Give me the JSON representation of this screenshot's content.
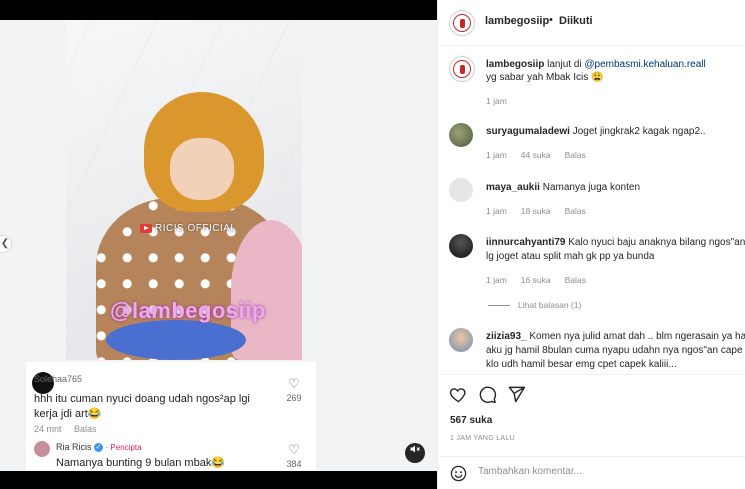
{
  "video": {
    "watermark_small": "RICIS OFFICIAL",
    "watermark_big": "@lambegosiip",
    "overlay": {
      "comment1": {
        "user": "Solehaa765",
        "text_line1": "hhh itu cuman nyuci doang udah ngos²ap lgi",
        "text_line2": "kerja jdi art😂",
        "time": "24 mnt",
        "reply": "Balas",
        "likes": "269"
      },
      "comment2": {
        "user": "Ria Ricis",
        "creator_label": "· Pencipta",
        "text": "Namanya bunting 9 bulan mbak😂",
        "likes": "384"
      }
    }
  },
  "header": {
    "username": "lambegosiip",
    "dot": "•",
    "follow_status": "Diikuti"
  },
  "caption": {
    "username": "lambegosiip",
    "prefix": "lanjut di",
    "mention": "@pembasmi.kehaluan.reall",
    "line2": "yg sabar yah Mbak Icis 😩",
    "time": "1 jam"
  },
  "comments": [
    {
      "user": "suryagumaladewi",
      "text": "Joget jingkrak2 kagak ngap2..",
      "time": "1 jam",
      "likes": "44 suka",
      "reply": "Balas"
    },
    {
      "user": "maya_aukii",
      "text": "Namanya juga konten",
      "time": "1 jam",
      "likes": "18 suka",
      "reply": "Balas"
    },
    {
      "user": "iinnurcahyanti79",
      "text": "Kalo nyuci baju anaknya bilang ngos\"an",
      "text_line2": "lg joget atau split mah gk pp ya bunda",
      "time": "1 jam",
      "likes": "16 suka",
      "reply": "Balas",
      "view_replies": "Lihat balasan (1)"
    },
    {
      "user": "ziizia93_",
      "text": "Komen nya julid amat dah .. blm ngerasain ya ha",
      "text_line2": "aku jg hamil 8bulan cuma nyapu udahn nya ngos\"an cape",
      "text_line3": "klo udh hamil besar emg cpet capek kaliii..."
    }
  ],
  "post": {
    "likes": "567 suka",
    "time_ago": "1 JAM YANG LALU"
  },
  "add_comment": {
    "placeholder": "Tambahkan komentar..."
  },
  "icons": {
    "like": "heart-icon",
    "comment": "comment-icon",
    "share": "share-icon",
    "emoji": "smiley-icon",
    "mute": "muted-speaker-icon",
    "prev": "chevron-left-icon"
  },
  "colors": {
    "mention": "#00376b",
    "secondary_text": "#8e8e8e",
    "creator_badge": "#e0245e",
    "verified": "#3897f0"
  }
}
